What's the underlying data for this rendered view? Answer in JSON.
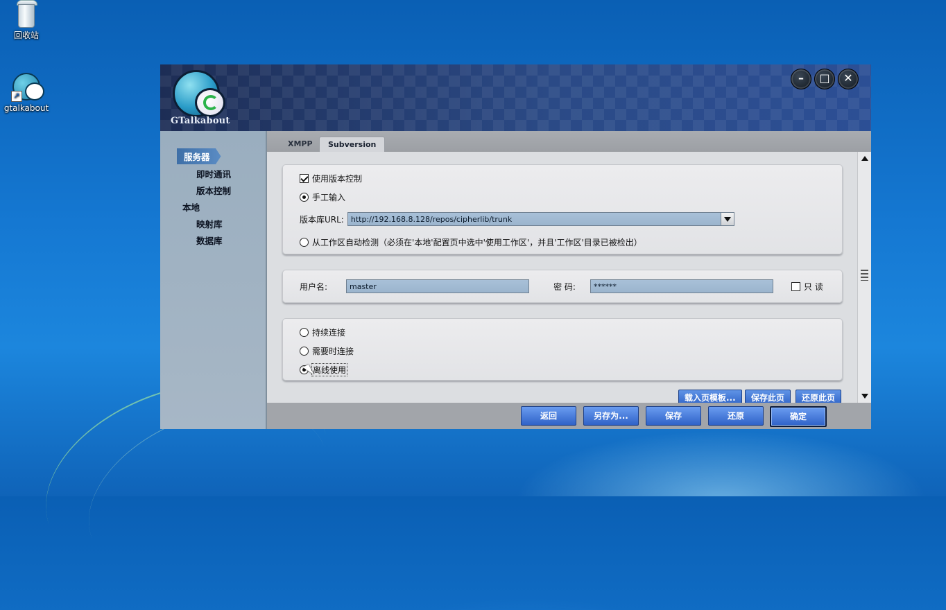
{
  "desktop": {
    "icons": [
      {
        "label": "回收站",
        "icon": "recycle-bin-icon"
      },
      {
        "label": "gtalkabout",
        "icon": "gtalkabout-app-icon"
      }
    ]
  },
  "app": {
    "logo_text": "GTalkabout",
    "window_buttons": {
      "minimize": "–",
      "maximize": "□",
      "close": "✕"
    },
    "sidebar": {
      "items": [
        {
          "label": "服务器",
          "level": 0,
          "active": true
        },
        {
          "label": "即时通讯",
          "level": 1
        },
        {
          "label": "版本控制",
          "level": 1
        },
        {
          "label": "本地",
          "level": 0
        },
        {
          "label": "映射库",
          "level": 1
        },
        {
          "label": "数据库",
          "level": 1
        }
      ]
    },
    "tabs": [
      {
        "label": "XMPP",
        "active": false
      },
      {
        "label": "Subversion",
        "active": true
      }
    ],
    "panel1": {
      "use_version_control": {
        "label": "使用版本控制",
        "checked": true
      },
      "manual_input": {
        "label": "手工输入",
        "selected": true
      },
      "repo_url": {
        "label": "版本库URL:",
        "value": "http://192.168.8.128/repos/cipherlib/trunk"
      },
      "auto_detect": {
        "label": "从工作区自动检测（必须在'本地'配置页中选中'使用工作区'，并且'工作区'目录已被检出）",
        "selected": false
      }
    },
    "panel2": {
      "username": {
        "label": "用户名:",
        "value": "master"
      },
      "password": {
        "label": "密  码:",
        "value": "******"
      },
      "readonly": {
        "label": "只 读",
        "checked": false
      }
    },
    "panel3": {
      "options": [
        {
          "label": "持续连接",
          "selected": false
        },
        {
          "label": "需要时连接",
          "selected": false
        },
        {
          "label": "离线使用",
          "selected": true
        }
      ]
    },
    "page_buttons": [
      "载入页模板...",
      "保存此页",
      "还原此页"
    ],
    "footer_buttons": [
      "返回",
      "另存为...",
      "保存",
      "还原",
      "确定"
    ],
    "colors": {
      "accent": "#2f63c7",
      "banner": "#1d2d55",
      "sidebar": "#9aaebf"
    }
  }
}
